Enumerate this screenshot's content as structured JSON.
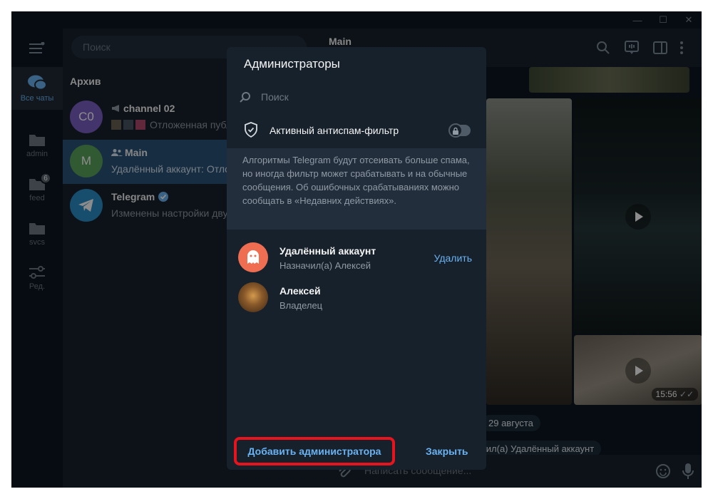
{
  "window": {
    "minimize": "—",
    "maximize": "☐",
    "close": "✕"
  },
  "rail": {
    "items": [
      {
        "label": "Все чаты"
      },
      {
        "label": "admin"
      },
      {
        "label": "feed",
        "badge": "6"
      },
      {
        "label": "svcs"
      },
      {
        "label": "Ред."
      }
    ]
  },
  "chatlist": {
    "search_placeholder": "Поиск",
    "section": "Архив",
    "chats": [
      {
        "initials": "C0",
        "name": "channel 02",
        "preview": "Отложенная публ"
      },
      {
        "initials": "M",
        "name": "Main",
        "preview": "Удалённый аккаунт: Отлож"
      },
      {
        "name": "Telegram",
        "preview": "Изменены настройки двух"
      }
    ]
  },
  "main": {
    "title": "Main",
    "video_time": "15:56",
    "date_pill": "29 августа",
    "service_pill": "чил(а) Удалённый аккаунт",
    "composer_placeholder": "Написать сообщение..."
  },
  "dialog": {
    "title": "Администраторы",
    "search_placeholder": "Поиск",
    "antispam_label": "Активный антиспам-фильтр",
    "antispam_info": "Алгоритмы Telegram будут отсеивать больше спама, но иногда фильтр может срабатывать и на обычные сообщения. Об ошибочных срабатываниях можно сообщать в «Недавних действиях».",
    "admins": [
      {
        "name": "Удалённый аккаунт",
        "role": "Назначил(а) Алексей",
        "action": "Удалить"
      },
      {
        "name": "Алексей",
        "role": "Владелец"
      }
    ],
    "add_button": "Добавить администратора",
    "close_button": "Закрыть"
  },
  "colors": {
    "accent": "#6ab2f2",
    "bg": "#17212b",
    "active_chat": "#2b5278",
    "highlight": "#e8141d"
  }
}
